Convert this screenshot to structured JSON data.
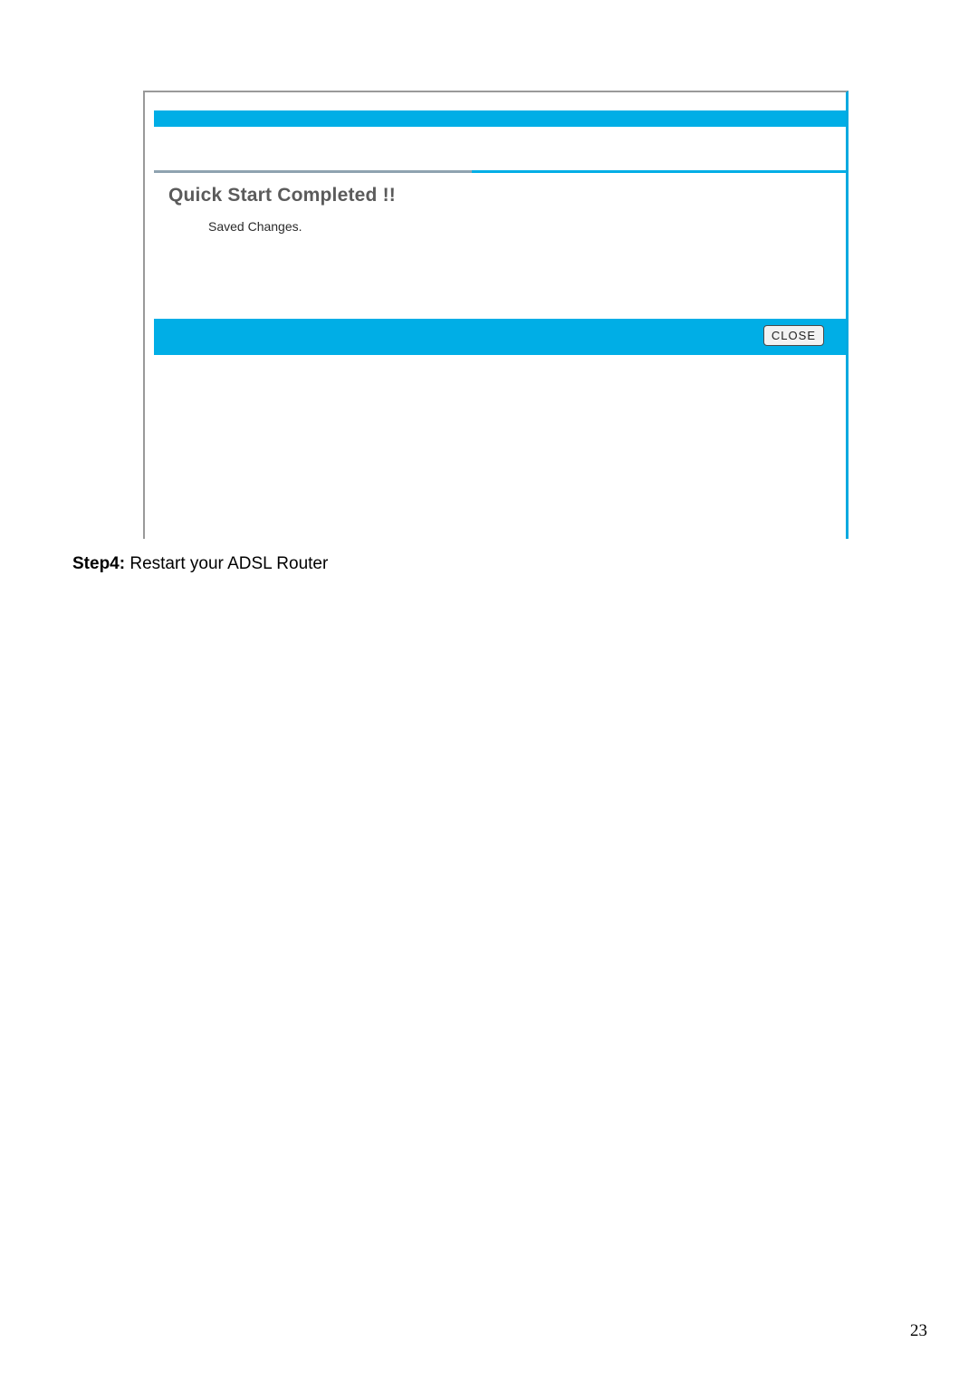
{
  "dialog": {
    "heading": "Quick Start Completed !!",
    "message": "Saved Changes.",
    "close_label": "CLOSE"
  },
  "caption": {
    "step_label": "Step4:",
    "step_text": " Restart your ADSL Router"
  },
  "page_number": "23"
}
